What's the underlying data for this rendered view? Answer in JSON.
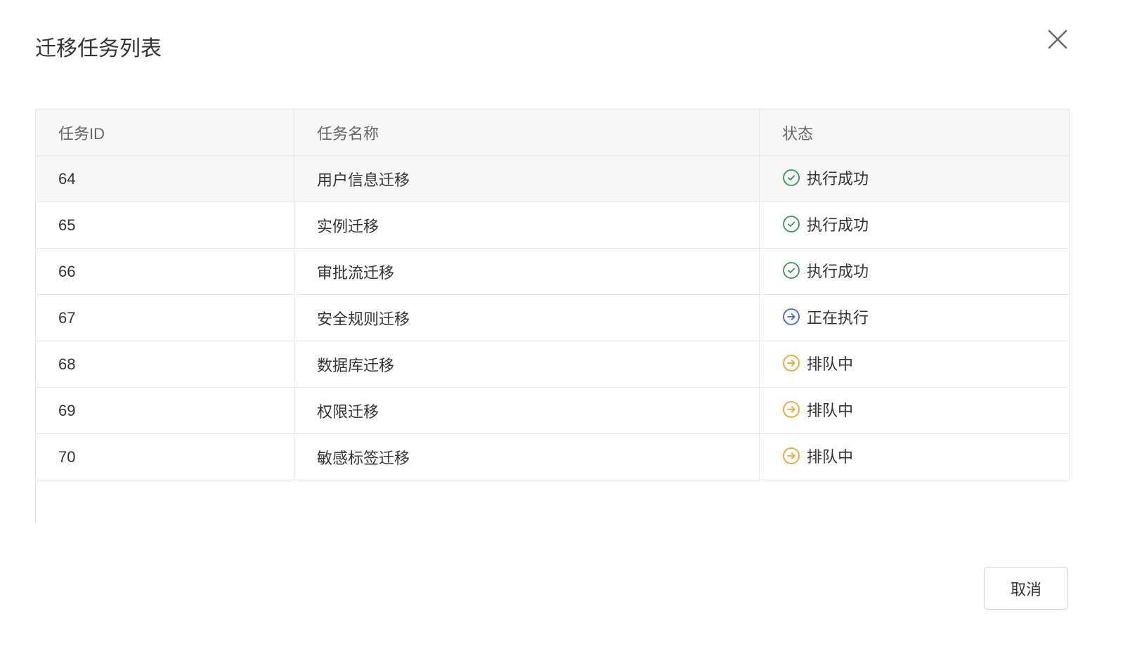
{
  "dialog": {
    "title": "迁移任务列表",
    "close_icon": "close-icon",
    "cancel_label": "取消"
  },
  "table": {
    "columns": [
      "任务ID",
      "任务名称",
      "状态"
    ],
    "rows": [
      {
        "id": "64",
        "name": "用户信息迁移",
        "status": "执行成功",
        "status_icon": "check-circle-icon",
        "status_color": "#2d9b53"
      },
      {
        "id": "65",
        "name": "实例迁移",
        "status": "执行成功",
        "status_icon": "check-circle-icon",
        "status_color": "#2d9b53"
      },
      {
        "id": "66",
        "name": "审批流迁移",
        "status": "执行成功",
        "status_icon": "check-circle-icon",
        "status_color": "#2d9b53"
      },
      {
        "id": "67",
        "name": "安全规则迁移",
        "status": "正在执行",
        "status_icon": "arrow-right-circle-icon",
        "status_color": "#3a63e6"
      },
      {
        "id": "68",
        "name": "数据库迁移",
        "status": "排队中",
        "status_icon": "arrow-right-circle-icon",
        "status_color": "#f2a323"
      },
      {
        "id": "69",
        "name": "权限迁移",
        "status": "排队中",
        "status_icon": "arrow-right-circle-icon",
        "status_color": "#f2a323"
      },
      {
        "id": "70",
        "name": "敏感标签迁移",
        "status": "排队中",
        "status_icon": "arrow-right-circle-icon",
        "status_color": "#f2a323"
      }
    ]
  },
  "colors": {
    "border": "#e8e8e8",
    "header_background": "#f7f7f7",
    "hover_row_background": "#f7f7f7",
    "text": "#333333",
    "header_text": "#666666"
  }
}
